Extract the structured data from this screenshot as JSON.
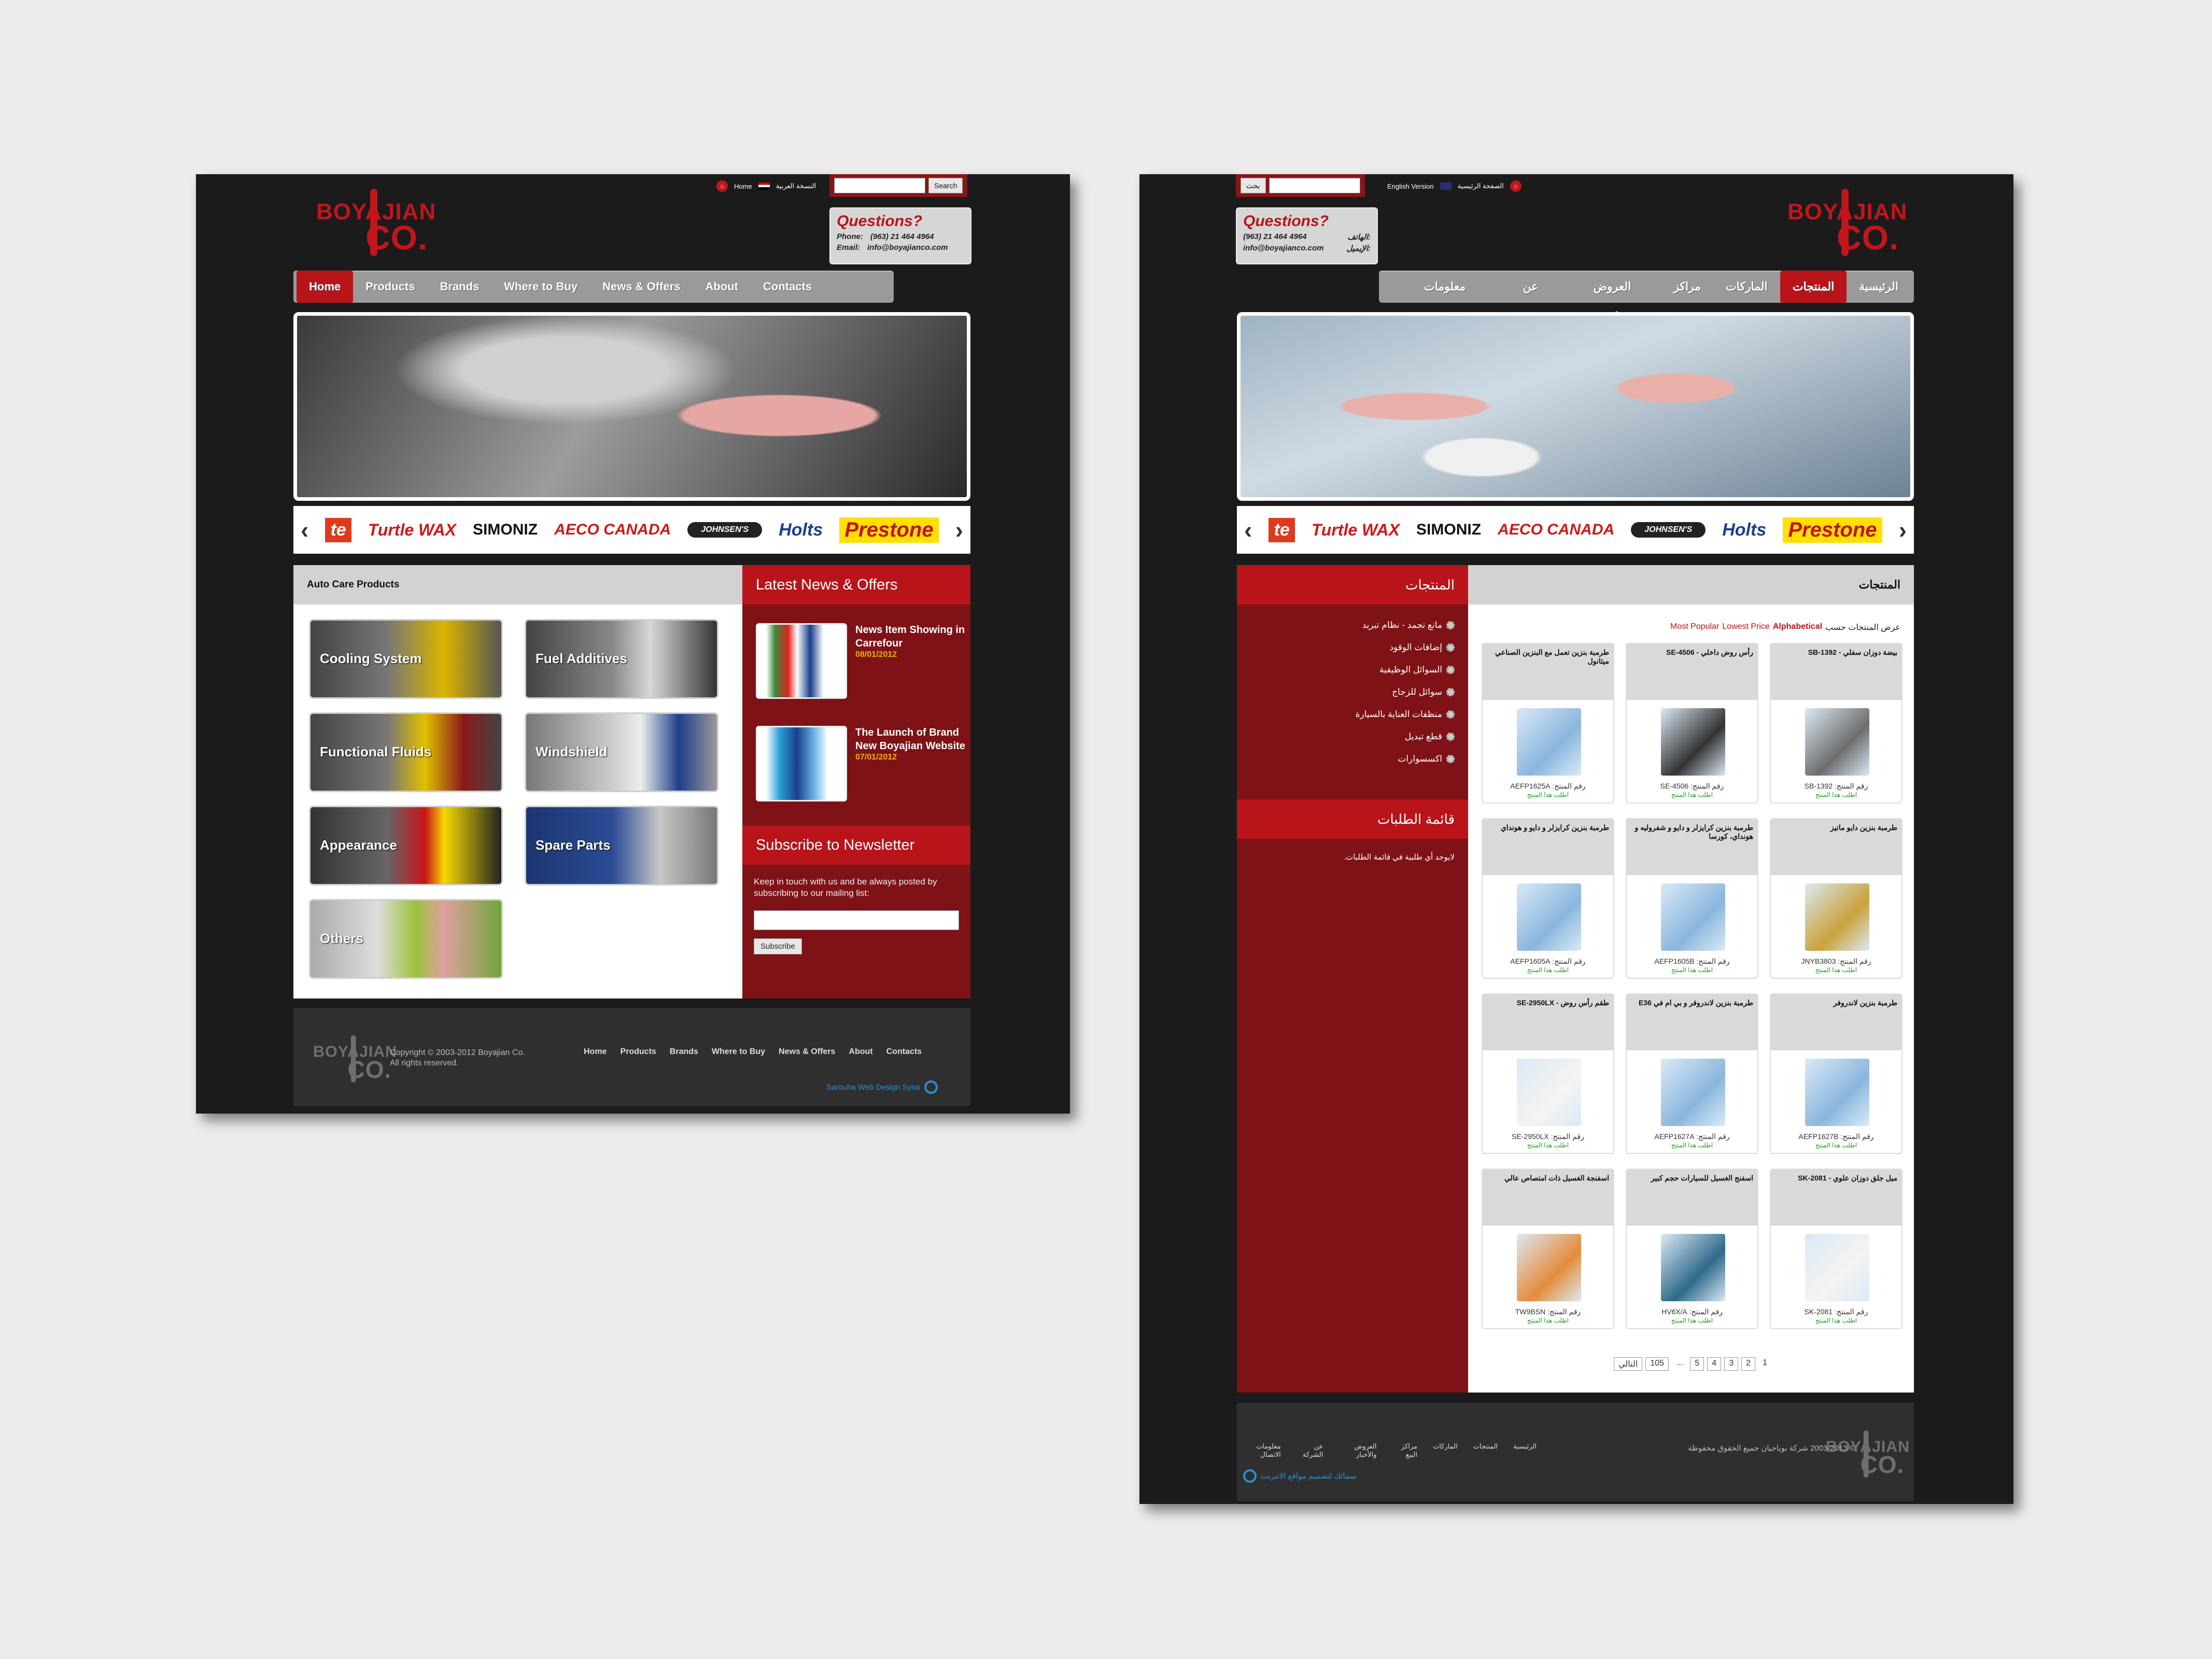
{
  "english": {
    "toplinks": {
      "home": "Home",
      "arabic": "النسخة العربية"
    },
    "search_button": "Search",
    "questions": {
      "title": "Questions?",
      "phone_label": "Phone:",
      "phone": "(963) 21 464 4964",
      "email_label": "Email:",
      "email": "info@boyajianco.com"
    },
    "nav": [
      "Home",
      "Products",
      "Brands",
      "Where to Buy",
      "News & Offers",
      "About",
      "Contacts"
    ],
    "brands": [
      "te",
      "Turtle WAX",
      "SIMONIZ",
      "AECO CANADA",
      "JOHNSEN'S",
      "Holts",
      "Prestone"
    ],
    "products_heading": "Auto Care Products",
    "categories": [
      "Cooling System",
      "Fuel Additives",
      "Functional Fluids",
      "Windshield",
      "Appearance",
      "Spare Parts",
      "Others"
    ],
    "news_heading": "Latest News & Offers",
    "news": [
      {
        "title": "News Item Showing in Carrefour",
        "date": "08/01/2012"
      },
      {
        "title": "The Launch of Brand New Boyajian Website",
        "date": "07/01/2012"
      }
    ],
    "newsletter": {
      "heading": "Subscribe to Newsletter",
      "text": "Keep in touch with us and be always posted by subscribing to our mailing list:",
      "button": "Subscribe"
    },
    "footer": {
      "copyright": "Copyright © 2003-2012 Boyajian Co.",
      "rights": "All rights reserved.",
      "links": [
        "Home",
        "Products",
        "Brands",
        "Where to Buy",
        "News & Offers",
        "About",
        "Contacts"
      ],
      "credit": "Sarouha Web Design Syria"
    }
  },
  "arabic": {
    "toplinks": {
      "english": "English Version",
      "home": "الصفحة الرئيسية"
    },
    "search_button": "بحث",
    "questions": {
      "title": "Questions?",
      "phone_label": "الهاتف:",
      "phone": "(963) 21 464 4964",
      "email_label": "الإيميل:",
      "email": "info@boyajianco.com"
    },
    "nav": [
      "الرئيسية",
      "المنتجات",
      "الماركات",
      "مراكز البيع",
      "العروض والأخبار",
      "عن الشركة",
      "معلومات الاتصال"
    ],
    "products_heading": "المنتجات",
    "sort": {
      "label": "عرض المنتجات حسب",
      "options": [
        "Alphabetical",
        "Lowest Price",
        "Most Popular"
      ]
    },
    "sidebar_heading": "المنتجات",
    "sidebar_items": [
      "مانع تجمد - نظام تبريد",
      "إضافات الوقود",
      "السوائل الوظيفية",
      "سوائل للزجاج",
      "منظفات العناية بالسيارة",
      "قطع تبديل",
      "اكسسوارات"
    ],
    "cart_heading": "قائمة الطلبات",
    "cart_empty": "لايوجد أي طلبية في قائمة الطلبات.",
    "products": [
      {
        "name": "بيضة دوزان سفلي - SB-1392",
        "no": "رقم المنتج: SB-1392",
        "order": "اطلب هذا المنتج"
      },
      {
        "name": "رأس روض داخلي - SE-4506",
        "no": "رقم المنتج: SE-4506",
        "order": "اطلب هذا المنتج"
      },
      {
        "name": "طرمبة بنزين تعمل مع البنزين الصناعي ميثانول",
        "no": "رقم المنتج: AEFP1625A",
        "order": "اطلب هذا المنتج"
      },
      {
        "name": "طرمبة بنزين دايو ماتيز",
        "no": "رقم المنتج: JNYB3803",
        "order": "اطلب هذا المنتج"
      },
      {
        "name": "طرمبة بنزين كرايزلر و دايو و شفروليه و هونداي، كورسا",
        "no": "رقم المنتج: AEFP1605B",
        "order": "اطلب هذا المنتج"
      },
      {
        "name": "طرمبة بنزين كرايزلر و دايو و هونداي",
        "no": "رقم المنتج: AEFP1605A",
        "order": "اطلب هذا المنتج"
      },
      {
        "name": "طرمبة بنزين لاندروفر",
        "no": "رقم المنتج: AEFP1627B",
        "order": "اطلب هذا المنتج"
      },
      {
        "name": "طرمبة بنزين لاندروفر و بي ام في E36",
        "no": "رقم المنتج: AEFP1627A",
        "order": "اطلب هذا المنتج"
      },
      {
        "name": "طقم رأس روض - SE-2950LX",
        "no": "رقم المنتج: SE-2950LX",
        "order": "اطلب هذا المنتج"
      },
      {
        "name": "ميل جلق دوزان علوي - SK-2081",
        "no": "رقم المنتج: SK-2081",
        "order": "اطلب هذا المنتج"
      },
      {
        "name": "اسفنج الغسيل للسيارات حجم كبير",
        "no": "رقم المنتج: HV6X/A",
        "order": "اطلب هذا المنتج"
      },
      {
        "name": "اسفنجة الغسيل ذات امتصاص عالي",
        "no": "رقم المنتج: TW9BSN",
        "order": "اطلب هذا المنتج"
      }
    ],
    "pagination": [
      "1",
      "2",
      "3",
      "4",
      "5",
      "...",
      "105",
      "التالي"
    ],
    "footer": {
      "copyright": "© 2003-2013 شركة بوياجيان جميع الحقوق محفوظة",
      "links": [
        "الرئيسية",
        "المنتجات",
        "الماركات",
        "مراكز البيع",
        "العروض والأخبار",
        "عن الشركة",
        "معلومات الاتصال"
      ],
      "credit": "سمائك لتصميم مواقع الانترنت"
    }
  },
  "colors": {
    "brand_red": "#b8141a",
    "dark_red": "#8a1518",
    "panel_bg": "#1b1b1b"
  }
}
